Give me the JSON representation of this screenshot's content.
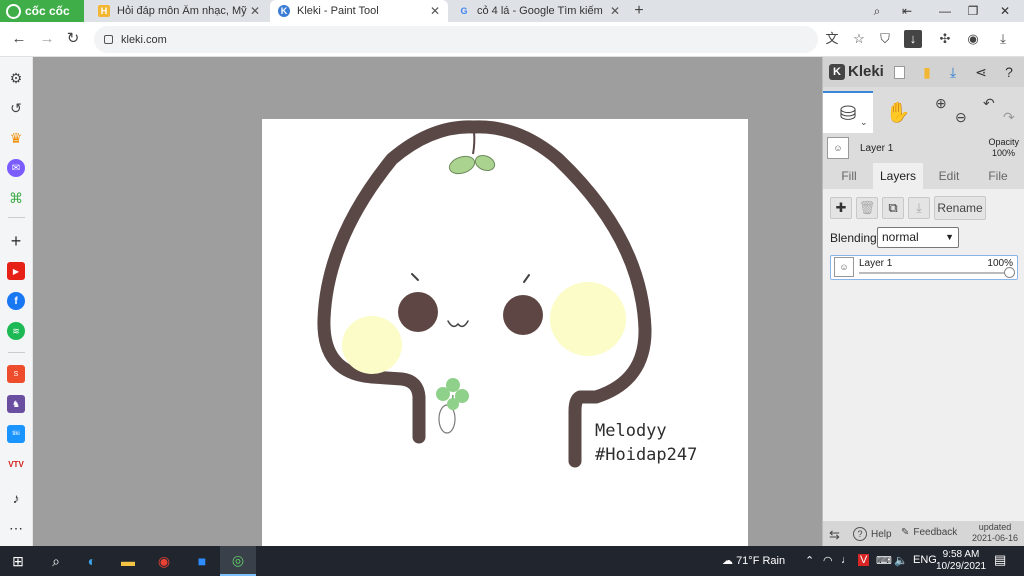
{
  "browser": {
    "brand": "cốc cốc",
    "tabs": [
      {
        "title": "Hỏi đáp môn Âm nhạc, Mỹ th",
        "favicon": "H",
        "active": false
      },
      {
        "title": "Kleki - Paint Tool",
        "favicon": "K",
        "active": true
      },
      {
        "title": "cỏ 4 lá - Google Tìm kiếm",
        "favicon": "G",
        "active": false
      }
    ],
    "url": "kleki.com"
  },
  "colors": {
    "brand_green": "#3fae49",
    "canvas_bg": "#9e9e9e",
    "outline_brown": "#5a4846",
    "blush_yellow": "#fbfcc7",
    "leaf_green": "#a9d38f",
    "clover_green": "#8fd08a",
    "accent_blue": "#3a86d8"
  },
  "canvas": {
    "signature_line1": "Melodyy",
    "signature_line2": "#Hoidap247"
  },
  "kleki": {
    "brand": "Kleki",
    "opacity_label": "Opacity",
    "opacity_value": "100%",
    "current_layer": "Layer 1",
    "tabs": [
      "Fill",
      "Layers",
      "Edit",
      "File"
    ],
    "active_tab": "Layers",
    "rename_label": "Rename",
    "blending_label": "Blending",
    "blending_value": "normal",
    "layers": [
      {
        "name": "Layer 1",
        "opacity": "100%",
        "opacity_fraction": 1.0
      }
    ],
    "footer": {
      "help": "Help",
      "feedback": "Feedback",
      "updated_label": "updated",
      "updated_date": "2021-06-16"
    }
  },
  "taskbar": {
    "weather_temp": "71°F",
    "weather_text": "Rain",
    "language": "ENG",
    "time": "9:58 AM",
    "date": "10/29/2021"
  }
}
